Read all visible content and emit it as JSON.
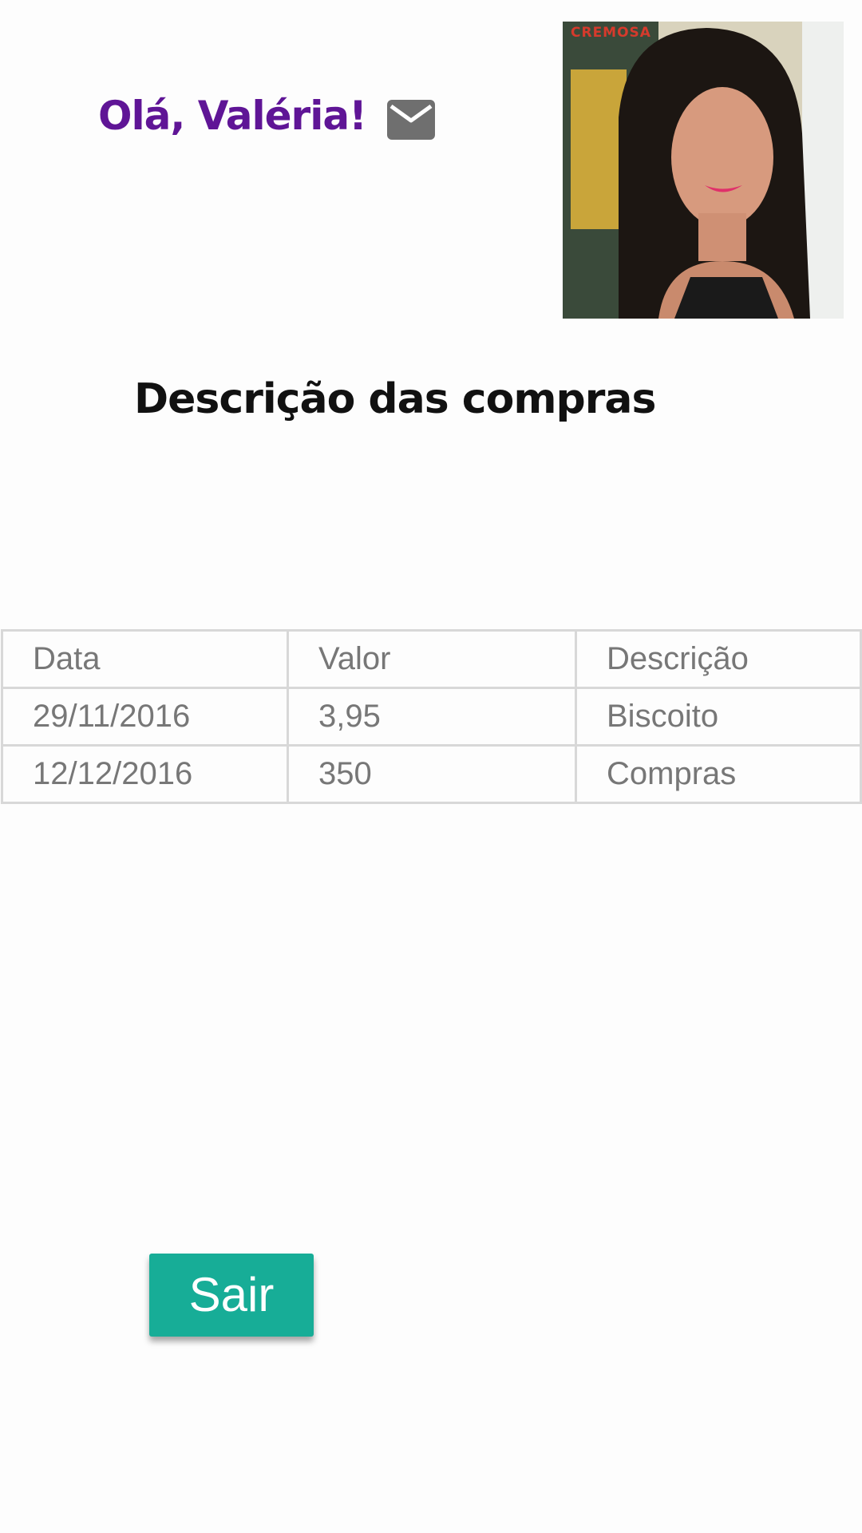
{
  "header": {
    "greeting": "Olá, Valéria!",
    "mail_icon": "mail-icon",
    "photo_label": "CREMOSA"
  },
  "section": {
    "title": "Descrição das compras"
  },
  "purchases": {
    "columns": [
      "Data",
      "Valor",
      "Descrição"
    ],
    "rows": [
      [
        "29/11/2016",
        "3,95",
        "Biscoito"
      ],
      [
        "12/12/2016",
        "350",
        "Compras"
      ]
    ]
  },
  "actions": {
    "exit_label": "Sair"
  },
  "colors": {
    "greeting": "#5f1596",
    "button": "#17ad97",
    "table_border": "#d8d8d8",
    "table_text": "#777777"
  }
}
